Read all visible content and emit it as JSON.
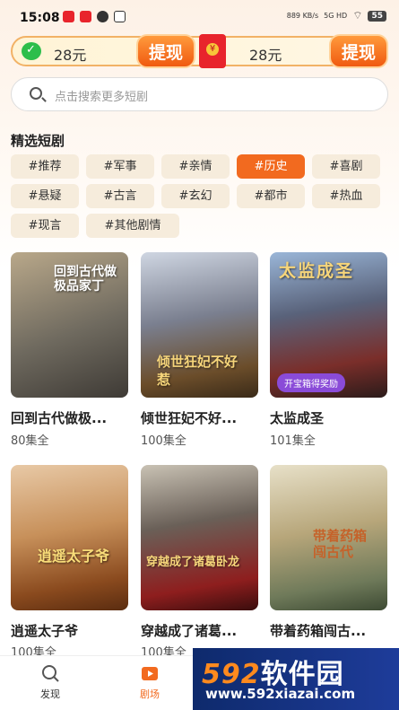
{
  "status_bar": {
    "time": "15:08",
    "net_speed": "889 KB/s",
    "network": "5G HD",
    "battery": "55"
  },
  "reward": {
    "left_amount": "28元",
    "left_button": "提现",
    "right_amount": "28元",
    "right_button": "提现"
  },
  "search": {
    "placeholder": "点击搜索更多短剧"
  },
  "section": {
    "title": "精选短剧"
  },
  "tags": [
    "#推荐",
    "#军事",
    "#亲情",
    "#历史",
    "#喜剧",
    "#悬疑",
    "#古言",
    "#玄幻",
    "#都市",
    "#热血",
    "#现言",
    "#其他剧情"
  ],
  "active_tag": "#历史",
  "dramas": [
    {
      "title": "回到古代做极...",
      "count": "80集全",
      "poster_text": "回到古代做极品家丁"
    },
    {
      "title": "倾世狂妃不好...",
      "count": "100集全",
      "poster_text": "倾世狂妃不好惹"
    },
    {
      "title": "太监成圣",
      "count": "101集全",
      "poster_text": "太监成圣",
      "badge": "开宝箱得奖励"
    },
    {
      "title": "逍遥太子爷",
      "count": "100集全",
      "poster_text": "逍遥太子爷"
    },
    {
      "title": "穿越成了诸葛...",
      "count": "100集全",
      "poster_text": "穿越成了诸葛卧龙"
    },
    {
      "title": "带着药箱闯古...",
      "count": "",
      "poster_text": "带着药箱闯古代"
    }
  ],
  "nav": {
    "discover": "发现",
    "theater": "剧场"
  },
  "watermark": {
    "main_num": "592",
    "main_text": "软件园",
    "url": "www.592xiazai.com"
  },
  "colors": {
    "accent": "#f26a1f",
    "tag_bg": "#f6ecdc",
    "reward_border": "#f2b266"
  }
}
